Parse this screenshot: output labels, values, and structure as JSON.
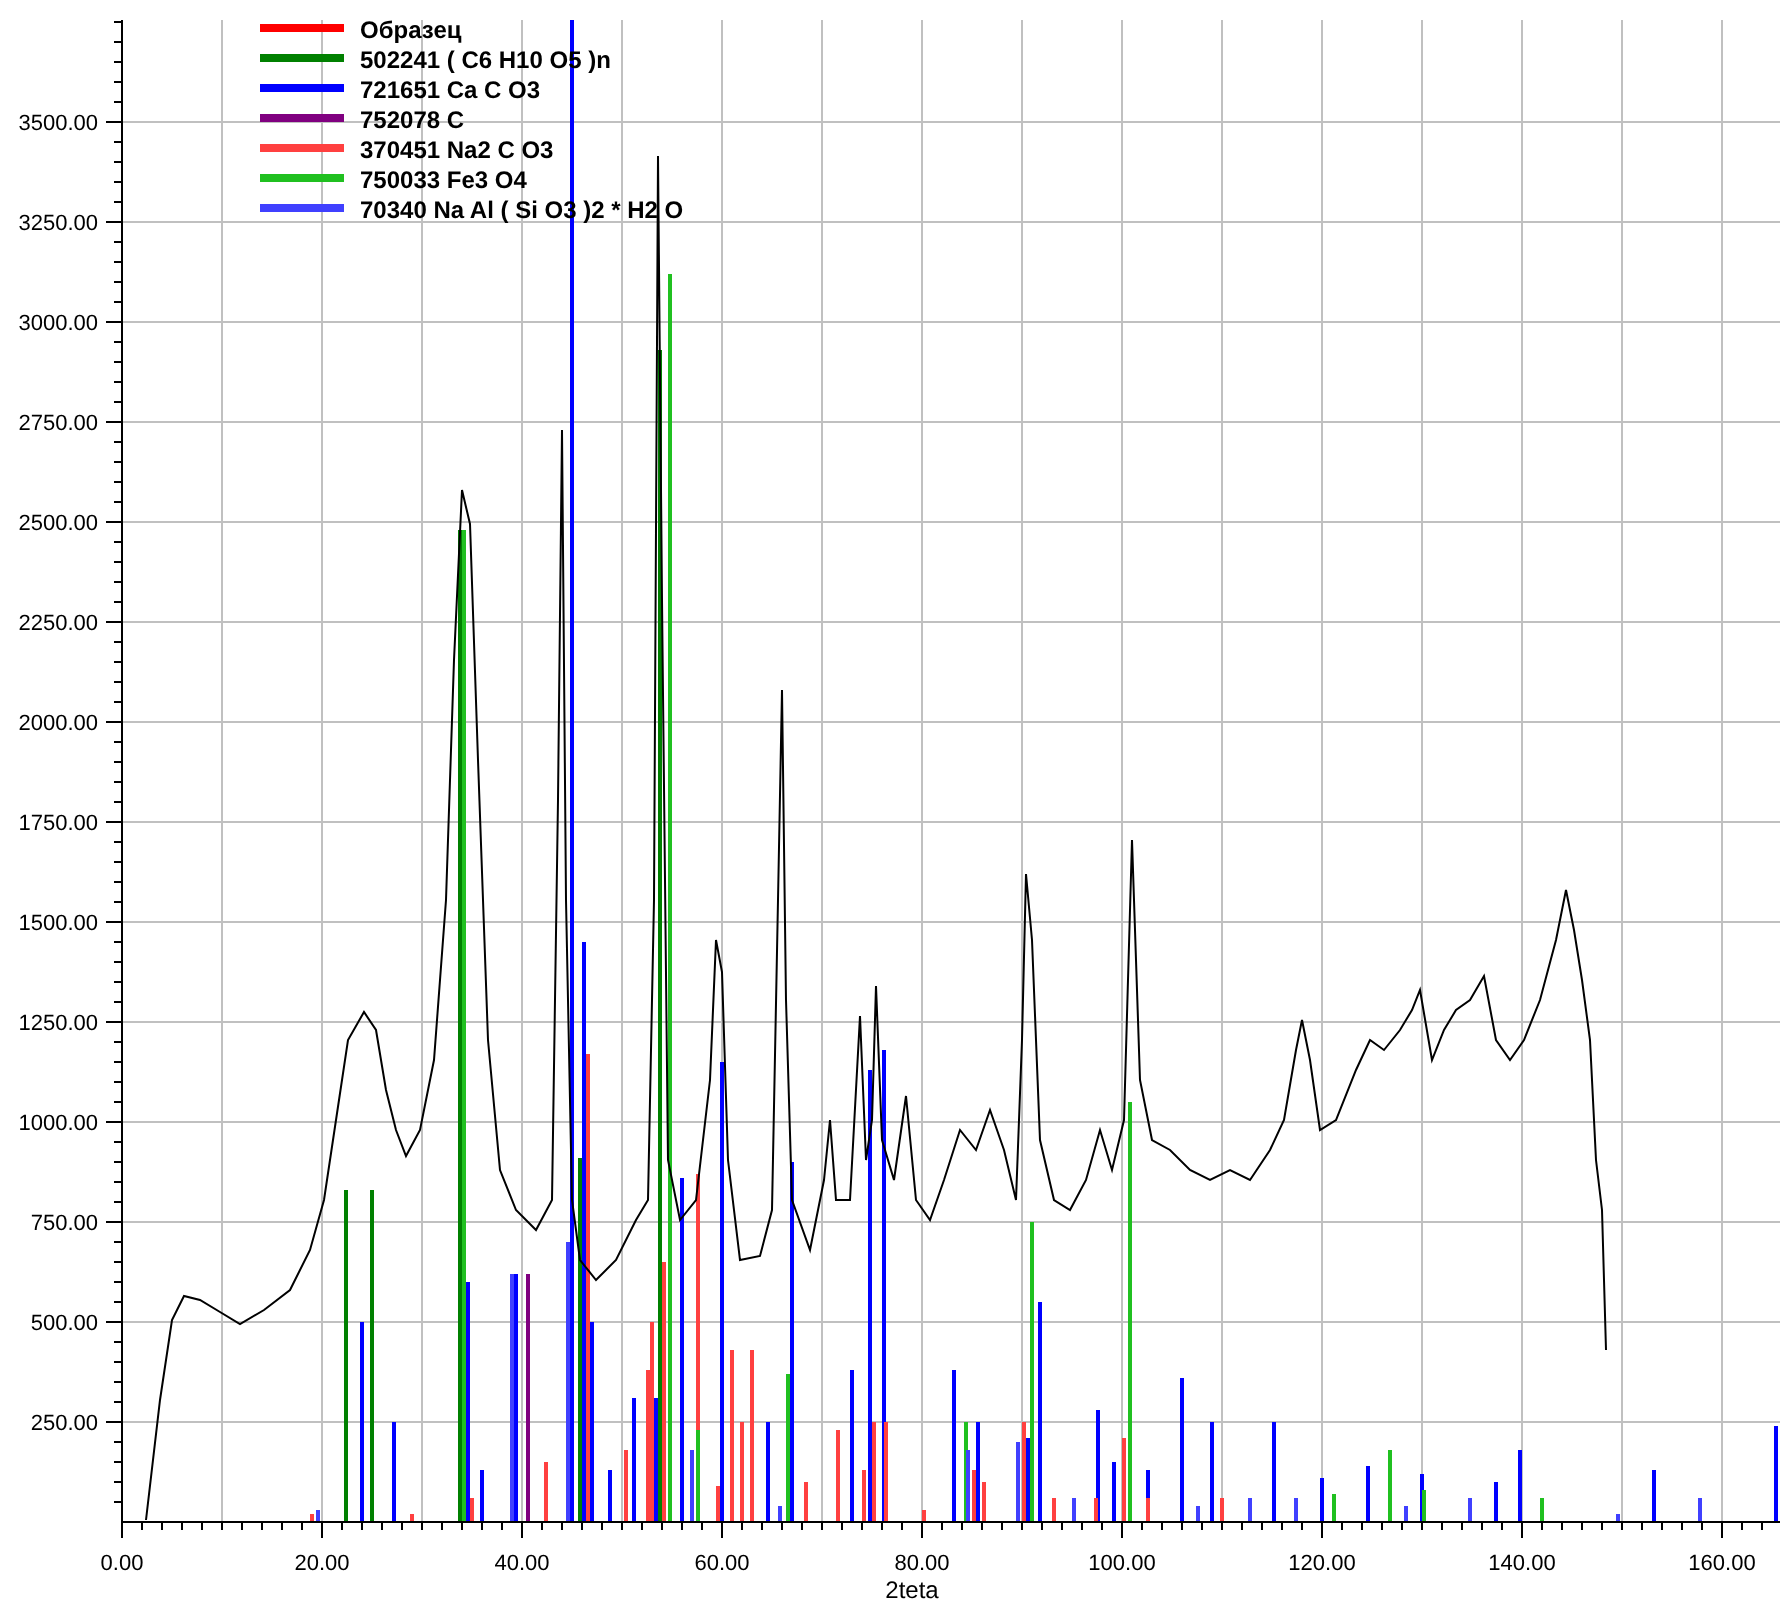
{
  "legend_swatches": [
    {
      "color": "#ff0000"
    },
    {
      "color": "#008000"
    },
    {
      "color": "#0000ff"
    },
    {
      "color": "#800080"
    },
    {
      "color": "#ff4040"
    },
    {
      "color": "#20c020"
    },
    {
      "color": "#4040ff"
    }
  ],
  "sample_plot": {
    "chart_data": {
      "type": "line",
      "xlabel": "2teta",
      "xlim": [
        0,
        165.8
      ],
      "ylim": [
        0,
        3755
      ],
      "xticks": [
        {
          "value": 0,
          "label": "0.00"
        },
        {
          "value": 20,
          "label": "20.00"
        },
        {
          "value": 40,
          "label": "40.00"
        },
        {
          "value": 60,
          "label": "60.00"
        },
        {
          "value": 80,
          "label": "80.00"
        },
        {
          "value": 100,
          "label": "100.00"
        },
        {
          "value": 120,
          "label": "120.00"
        },
        {
          "value": 140,
          "label": "140.00"
        },
        {
          "value": 160,
          "label": "160.00"
        }
      ],
      "yticks": [
        {
          "value": 250,
          "label": "250.00"
        },
        {
          "value": 500,
          "label": "500.00"
        },
        {
          "value": 750,
          "label": "750.00"
        },
        {
          "value": 1000,
          "label": "1000.00"
        },
        {
          "value": 1250,
          "label": "1250.00"
        },
        {
          "value": 1500,
          "label": "1500.00"
        },
        {
          "value": 1750,
          "label": "1750.00"
        },
        {
          "value": 2000,
          "label": "2000.00"
        },
        {
          "value": 2250,
          "label": "2250.00"
        },
        {
          "value": 2500,
          "label": "2500.00"
        },
        {
          "value": 2750,
          "label": "2750.00"
        },
        {
          "value": 3000,
          "label": "3000.00"
        },
        {
          "value": 3250,
          "label": "3250.00"
        },
        {
          "value": 3500,
          "label": "3500.00"
        }
      ],
      "x": [
        2.4,
        3.8,
        5,
        6.2,
        7.8,
        9.8,
        11.8,
        14.2,
        16.8,
        18.8,
        20.2,
        21.4,
        22.6,
        24.2,
        25.4,
        26.4,
        27.4,
        28.4,
        29.8,
        31.2,
        32.4,
        33.2,
        34,
        34.8,
        35.6,
        36.6,
        37.8,
        39.4,
        41.4,
        43,
        43.6,
        44,
        44.4,
        45,
        45.8,
        47.4,
        49.4,
        51.4,
        52.6,
        53.2,
        53.6,
        54,
        54.6,
        55.8,
        57.4,
        58.8,
        59.4,
        60,
        60.6,
        61.8,
        63.8,
        65,
        65.6,
        66,
        66.4,
        67,
        68.8,
        70.2,
        70.8,
        71.4,
        72.8,
        73.8,
        74.4,
        75,
        75.4,
        76,
        77.2,
        78.4,
        79.4,
        80.8,
        82.2,
        83.8,
        85.4,
        86.8,
        88.2,
        89.4,
        90,
        90.4,
        91,
        91.8,
        93.2,
        94.8,
        96.4,
        97.8,
        99,
        100.2,
        101,
        101.8,
        103,
        104.8,
        106.8,
        108.8,
        110.8,
        112.8,
        114.8,
        116.2,
        117.4,
        118,
        118.8,
        119.8,
        121.4,
        123.4,
        124.8,
        126.2,
        127.8,
        129,
        129.8,
        131,
        132.2,
        133.4,
        134.8,
        136.2,
        137.4,
        138.8,
        140.2,
        141.8,
        143.4,
        144.4,
        145.2,
        146,
        146.8,
        147.4,
        148,
        148.2,
        148.4
      ],
      "series": [
        {
          "name": "Образец",
          "color": "#000000",
          "values": [
            5,
            305,
            505,
            565,
            555,
            525,
            495,
            530,
            580,
            680,
            805,
            1005,
            1205,
            1275,
            1230,
            1080,
            980,
            915,
            980,
            1155,
            1555,
            2155,
            2580,
            2495,
            1905,
            1205,
            880,
            780,
            730,
            805,
            1805,
            2730,
            1555,
            805,
            655,
            605,
            655,
            755,
            805,
            1555,
            3415,
            2305,
            905,
            755,
            805,
            1105,
            1455,
            1375,
            905,
            655,
            665,
            780,
            1555,
            2080,
            1305,
            805,
            680,
            855,
            1005,
            805,
            805,
            1265,
            905,
            1005,
            1340,
            955,
            855,
            1065,
            805,
            755,
            855,
            980,
            930,
            1030,
            930,
            805,
            1205,
            1620,
            1455,
            955,
            805,
            780,
            855,
            980,
            880,
            1005,
            1705,
            1105,
            955,
            930,
            880,
            855,
            880,
            855,
            930,
            1005,
            1180,
            1255,
            1155,
            980,
            1005,
            1130,
            1205,
            1180,
            1230,
            1280,
            1330,
            1155,
            1230,
            1280,
            1305,
            1365,
            1205,
            1155,
            1205,
            1305,
            1455,
            1580,
            1480,
            1355,
            1205,
            905,
            780,
            605,
            430
          ]
        }
      ]
    }
  },
  "reference_patterns": {
    "chart_data": {
      "type": "bar",
      "xlim": [
        0,
        165.8
      ],
      "ylim": [
        0,
        3755
      ],
      "series": [
        {
          "name": "502241 ( C6 H10 O5 )n",
          "color": "#008000",
          "x": [
            22.4,
            25,
            33.8,
            45.8,
            53.8
          ],
          "values": [
            830,
            830,
            2480,
            910,
            2930
          ]
        },
        {
          "name": "721651 Ca C O3",
          "color": "#0000ff",
          "x": [
            24,
            27.2,
            34.6,
            36,
            39.4,
            45,
            46.2,
            47,
            48.8,
            51.2,
            53.4,
            56,
            60,
            64.6,
            67,
            73,
            74.8,
            76.2,
            83.2,
            85.6,
            90.6,
            91.8,
            97.6,
            99.2,
            102.6,
            106,
            109,
            115.2,
            120,
            124.6,
            130,
            137.4,
            139.8,
            153.2,
            165.4
          ],
          "values": [
            500,
            250,
            600,
            130,
            620,
            3755,
            1450,
            500,
            130,
            310,
            310,
            860,
            1150,
            250,
            900,
            380,
            1130,
            1180,
            380,
            250,
            210,
            550,
            280,
            150,
            130,
            360,
            250,
            250,
            110,
            140,
            120,
            100,
            180,
            130,
            240
          ]
        },
        {
          "name": "752078 C",
          "color": "#800080",
          "x": [
            40.6
          ],
          "values": [
            620
          ]
        },
        {
          "name": "370451 Na2 C O3",
          "color": "#ff4040",
          "x": [
            19,
            29,
            35,
            42.4,
            46.6,
            50.4,
            52.6,
            53,
            54.2,
            57.6,
            59.6,
            61,
            62,
            63,
            68.4,
            71.6,
            74.2,
            75.2,
            76.4,
            80.2,
            85.2,
            86.2,
            90.2,
            93.2,
            97.4,
            100.2,
            102.6,
            110
          ],
          "values": [
            20,
            20,
            60,
            150,
            1170,
            180,
            380,
            500,
            650,
            870,
            90,
            430,
            250,
            430,
            100,
            230,
            130,
            250,
            250,
            30,
            130,
            100,
            250,
            60,
            60,
            210,
            60,
            60
          ]
        },
        {
          "name": "750033 Fe3 O4",
          "color": "#20c020",
          "x": [
            34.2,
            54.8,
            57.6,
            66.6,
            84.4,
            91,
            100.8,
            121.2,
            126.8,
            130.2,
            142
          ],
          "values": [
            2480,
            3120,
            230,
            370,
            250,
            750,
            1050,
            70,
            180,
            80,
            60
          ]
        },
        {
          "name": "70340 Na Al ( Si O3 )2 * H2 O",
          "color": "#4040ff",
          "x": [
            19.6,
            39,
            44.6,
            57,
            65.8,
            84.6,
            89.6,
            95.2,
            107.6,
            112.8,
            117.4,
            128.4,
            134.8,
            149.6,
            157.8
          ],
          "values": [
            30,
            620,
            700,
            180,
            40,
            180,
            200,
            60,
            40,
            60,
            60,
            40,
            60,
            20,
            60
          ]
        }
      ]
    }
  }
}
